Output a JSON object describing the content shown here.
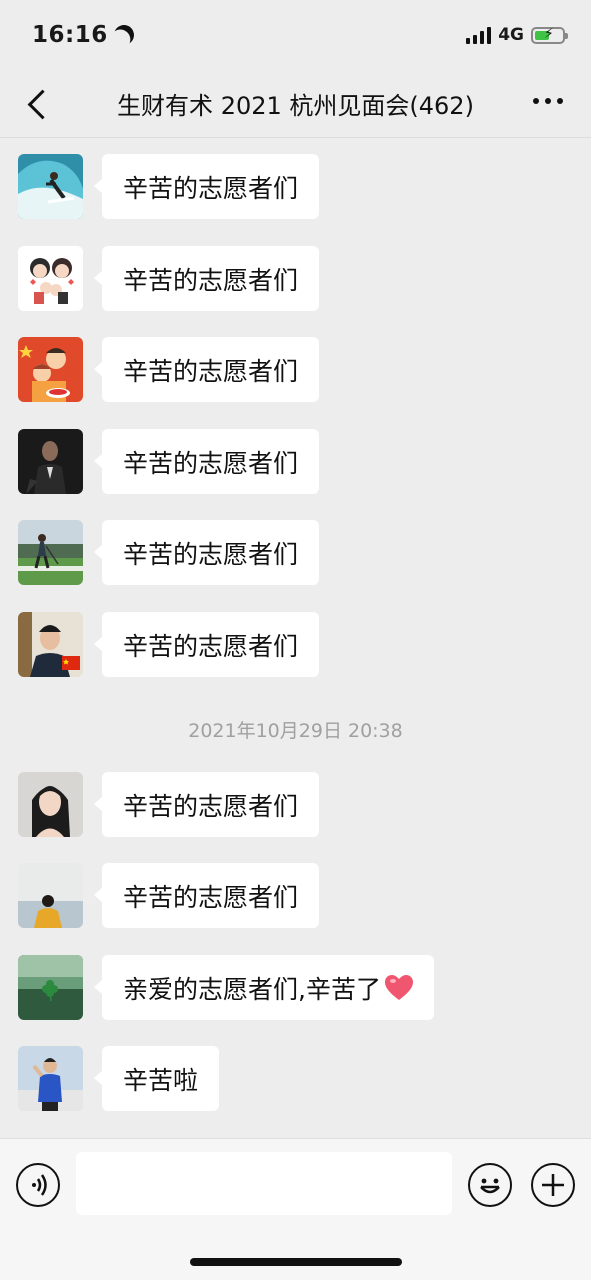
{
  "status_bar": {
    "time": "16:16",
    "network": "4G",
    "icons": [
      "moon-icon",
      "signal-icon",
      "battery-charging-icon"
    ]
  },
  "nav": {
    "title": "生财有术 2021 杭州见面会(462)",
    "icons": [
      "back-icon",
      "more-icon"
    ]
  },
  "messages": [
    {
      "avatar": "surfer-avatar",
      "text": "辛苦的志愿者们"
    },
    {
      "avatar": "cartoon-family-avatar",
      "text": "辛苦的志愿者们"
    },
    {
      "avatar": "cartoon-couple-avatar",
      "text": "辛苦的志愿者们"
    },
    {
      "avatar": "man-in-suit-avatar",
      "text": "辛苦的志愿者们"
    },
    {
      "avatar": "golfer-avatar",
      "text": "辛苦的志愿者们"
    },
    {
      "avatar": "young-man-flag-avatar",
      "text": "辛苦的志愿者们"
    },
    {
      "avatar": "woman-portrait-avatar",
      "text": "辛苦的志愿者们"
    },
    {
      "avatar": "man-seaside-avatar",
      "text": "辛苦的志愿者们"
    },
    {
      "avatar": "clover-avatar",
      "text": "亲爱的志愿者们,辛苦了",
      "emoji": "heart-emoji"
    },
    {
      "avatar": "man-blue-shirt-avatar",
      "text": "辛苦啦"
    }
  ],
  "timestamp": "2021年10月29日 20:38",
  "input_bar": {
    "value": "",
    "icons": [
      "voice-icon",
      "emoji-icon",
      "plus-icon"
    ]
  },
  "colors": {
    "background": "#ededed",
    "bubble": "#ffffff",
    "text": "#191919",
    "timestamp": "#a0a0a0",
    "battery": "#3ec345",
    "heart": "#f0566f"
  }
}
